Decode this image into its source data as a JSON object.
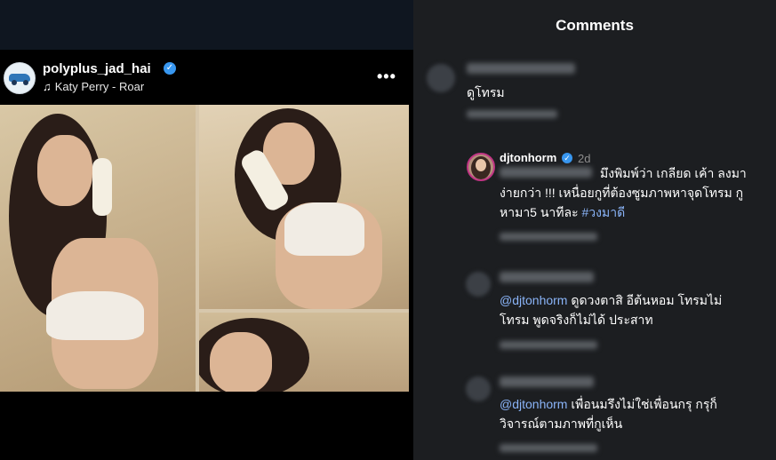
{
  "post": {
    "username": "polyplus_jad_hai",
    "music": "Katy Perry - Roar",
    "more": "•••"
  },
  "comments_panel": {
    "title": "Comments",
    "comment1": {
      "text": "ดูโทรม"
    },
    "reply": {
      "username": "djtonhorm",
      "time": "2d",
      "line1": "มึงพิมพ์ว่า เกลียด เค้า ลงมา",
      "line2": "ง่ายกว่า !!! เหนื่อยกูที่ต้องซูมภาพหาจุดโทรม กู",
      "line3_text": "หามา5 นาทีละ ",
      "line3_hashtag": "#วงมาดี"
    },
    "comment2": {
      "mention": "@djtonhorm",
      "line1": " ดูดวงตาสิ อีต้นหอม โทรมไม่",
      "line2": "โทรม พูดจริงก็ไม่ได้ ประสาท"
    },
    "comment3": {
      "mention": "@djtonhorm",
      "line1": " เพื่อนมรึงไม่ใช่เพื่อนกรุ กรุก็",
      "line2": "วิจารณ์ตามภาพที่กูเห็น"
    }
  },
  "icons": [
    "verified-badge-icon",
    "music-note-icon",
    "more-options-icon"
  ],
  "colors": {
    "verified": "#3897f0",
    "mention": "#8ab4f8",
    "panel_bg": "#1c1e21"
  }
}
